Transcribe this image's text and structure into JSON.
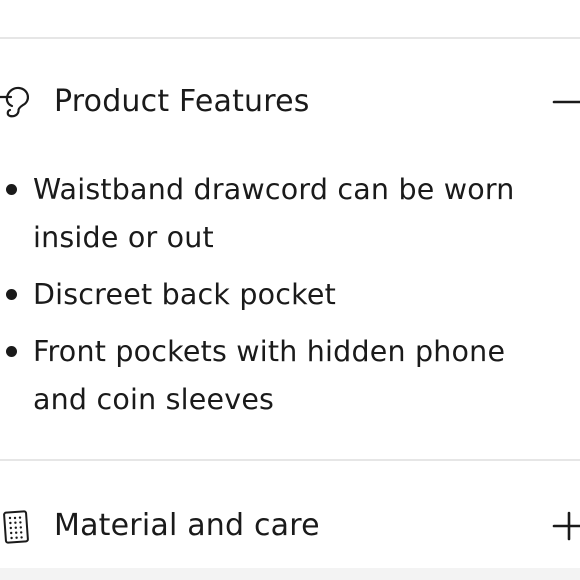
{
  "sections": {
    "features": {
      "title": "Product Features",
      "icon": "hanger-icon",
      "toggle": "collapse",
      "items": [
        {
          "text": "Waistband drawcord can be worn inside or out"
        },
        {
          "text": "Discreet back pocket"
        },
        {
          "text": "Front pockets with hidden phone and coin sleeves"
        }
      ]
    },
    "material": {
      "title": "Material and care",
      "icon": "fabric-swatch-icon",
      "toggle": "expand"
    }
  },
  "colors": {
    "text": "#1a1a1a",
    "divider": "#e6e6e6",
    "background": "#ffffff"
  }
}
